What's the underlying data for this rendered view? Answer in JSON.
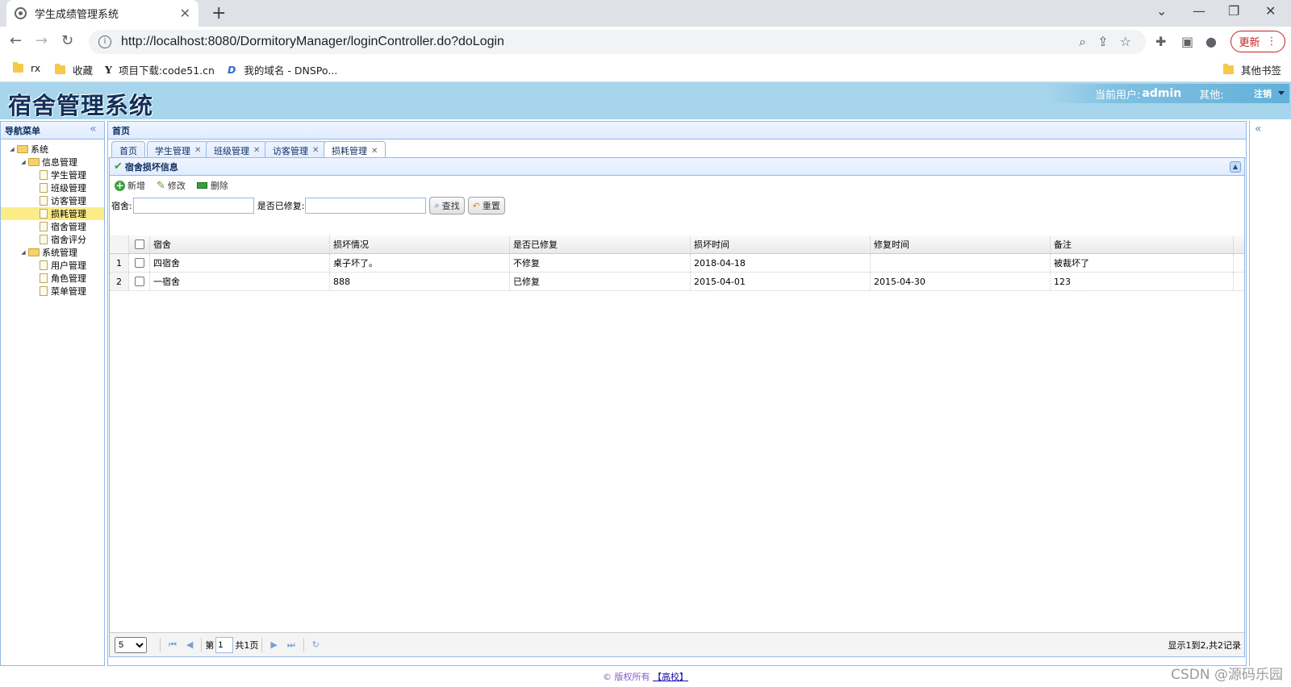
{
  "browser": {
    "tab_title": "学生成绩管理系统",
    "url": "http://localhost:8080/DormitoryManager/loginController.do?doLogin",
    "update_label": "更新",
    "bookmarks": [
      "rx",
      "收藏",
      "项目下载:code51.cn",
      "我的域名 - DNSPo...",
      "其他书签"
    ]
  },
  "app": {
    "logo": "宿舍管理系统",
    "current_user_label": "当前用户:",
    "current_user": "admin",
    "other_label": "其他:",
    "logout_label": "注销"
  },
  "west": {
    "title": "导航菜单",
    "tree": [
      {
        "label": "系统",
        "level": 0,
        "type": "folder"
      },
      {
        "label": "信息管理",
        "level": 1,
        "type": "folder"
      },
      {
        "label": "学生管理",
        "level": 2,
        "type": "page"
      },
      {
        "label": "班级管理",
        "level": 2,
        "type": "page"
      },
      {
        "label": "访客管理",
        "level": 2,
        "type": "page"
      },
      {
        "label": "损耗管理",
        "level": 2,
        "type": "page",
        "selected": true
      },
      {
        "label": "宿舍管理",
        "level": 2,
        "type": "page"
      },
      {
        "label": "宿舍评分",
        "level": 2,
        "type": "page"
      },
      {
        "label": "系统管理",
        "level": 1,
        "type": "folder"
      },
      {
        "label": "用户管理",
        "level": 2,
        "type": "page"
      },
      {
        "label": "角色管理",
        "level": 2,
        "type": "page"
      },
      {
        "label": "菜单管理",
        "level": 2,
        "type": "page"
      }
    ]
  },
  "center": {
    "title": "首页",
    "tabs": [
      "首页",
      "学生管理",
      "班级管理",
      "访客管理",
      "损耗管理"
    ],
    "panel_title": "宿舍损坏信息",
    "ops": {
      "add": "新增",
      "edit": "修改",
      "delete": "删除"
    },
    "search": {
      "dorm_label": "宿舍:",
      "repaired_label": "是否已修复:",
      "find_label": "查找",
      "reset_label": "重置"
    },
    "columns": [
      "宿舍",
      "损坏情况",
      "是否已修复",
      "损坏时间",
      "修复时间",
      "备注"
    ],
    "rows": [
      [
        "1",
        "四宿舍",
        "桌子坏了。",
        "不修复",
        "2018-04-18",
        "",
        "被裁坏了"
      ],
      [
        "2",
        "一宿舍",
        "888",
        "已修复",
        "2015-04-01",
        "2015-04-30",
        "123"
      ]
    ],
    "pager": {
      "page_size": "5",
      "page_prefix": "第",
      "page_value": "1",
      "page_total": "共1页",
      "info": "显示1到2,共2记录"
    }
  },
  "footer": {
    "copyright": "© 版权所有",
    "link": "【高校】"
  },
  "watermark": "CSDN @源码乐园"
}
